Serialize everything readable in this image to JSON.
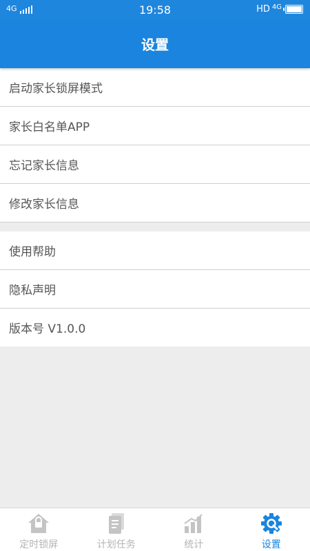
{
  "status_bar": {
    "network_left": "4G",
    "time": "19:58",
    "hd": "HD",
    "network_right": "4G"
  },
  "header": {
    "title": "设置"
  },
  "settings": {
    "group1": [
      {
        "label": "启动家长锁屏模式"
      },
      {
        "label": "家长白名单APP"
      },
      {
        "label": "忘记家长信息"
      },
      {
        "label": "修改家长信息"
      }
    ],
    "group2": [
      {
        "label": "使用帮助"
      },
      {
        "label": "隐私声明"
      },
      {
        "label": "版本号 V1.0.0"
      }
    ]
  },
  "tabs": [
    {
      "label": "定时锁屏",
      "icon": "house-lock-icon",
      "active": false
    },
    {
      "label": "计划任务",
      "icon": "document-list-icon",
      "active": false
    },
    {
      "label": "统计",
      "icon": "bar-chart-icon",
      "active": false
    },
    {
      "label": "设置",
      "icon": "gear-icon",
      "active": true
    }
  ],
  "colors": {
    "accent": "#1a84df",
    "inactive_tab": "#b4b4b4",
    "background": "#ededed"
  }
}
